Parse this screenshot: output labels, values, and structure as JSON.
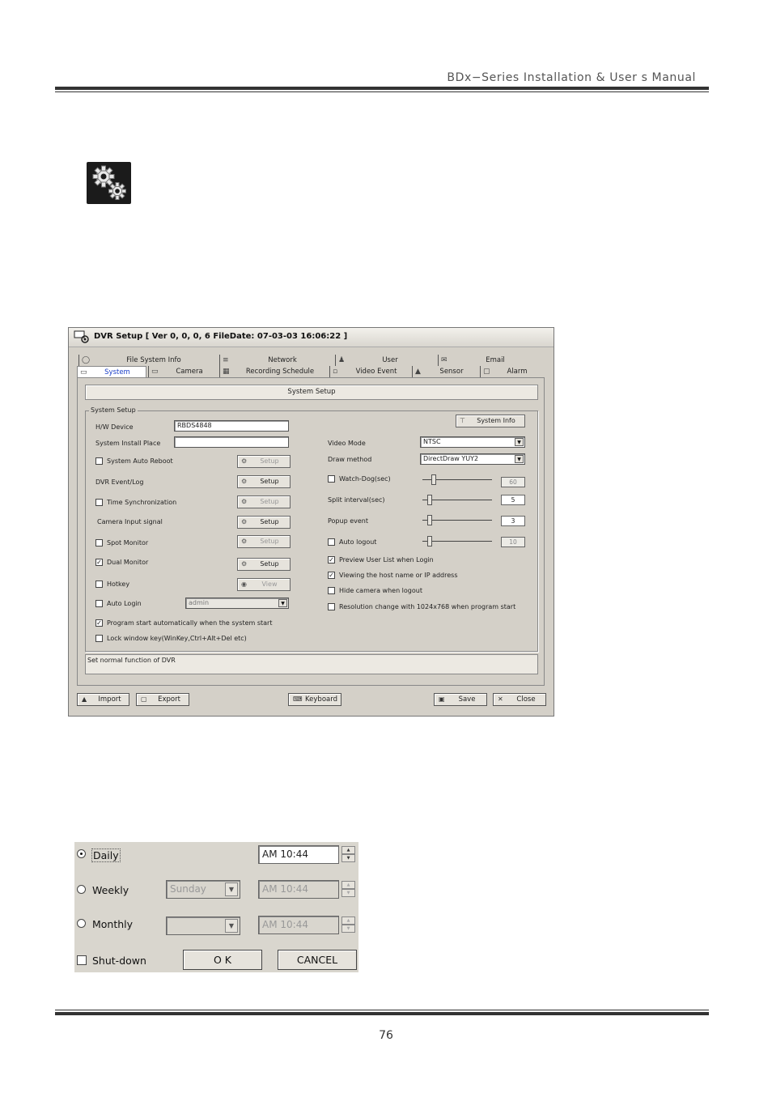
{
  "header": {
    "title": "BDx−Series Installation & User s Manual"
  },
  "window": {
    "title": "DVR Setup [ Ver 0, 0, 0, 6   FileDate: 07-03-03 16:06:22 ]",
    "tabs_top": [
      "File System Info",
      "Network",
      "User",
      "Email"
    ],
    "tabs_bottom": [
      "System",
      "Camera",
      "Recording Schedule",
      "Video Event",
      "Sensor",
      "Alarm"
    ],
    "section_title": "System Setup",
    "group_title": "System Setup",
    "left": {
      "hw_device_label": "H/W Device",
      "hw_device_value": "RBDS4848",
      "install_place_label": "System Install Place",
      "install_place_value": "",
      "auto_reboot": "System Auto Reboot",
      "event_log": "DVR Event/Log",
      "time_sync": "Time Synchronization",
      "camera_input": "Camera Input signal",
      "spot_monitor": "Spot Monitor",
      "dual_monitor": "Dual Monitor",
      "hotkey": "Hotkey",
      "auto_login": "Auto Login",
      "auto_login_user": "admin",
      "program_start": "Program start automatically when the system start",
      "lock_window": "Lock window key(WinKey,Ctrl+Alt+Del etc)",
      "setup_label": "Setup",
      "view_label": "View"
    },
    "right": {
      "system_info_btn": "System Info",
      "video_mode_label": "Video Mode",
      "video_mode_value": "NTSC",
      "draw_method_label": "Draw method",
      "draw_method_value": "DirectDraw YUY2",
      "watchdog_label": "Watch-Dog(sec)",
      "watchdog_value": "60",
      "split_label": "Split interval(sec)",
      "split_value": "5",
      "popup_label": "Popup event",
      "popup_value": "3",
      "auto_logout_label": "Auto logout",
      "auto_logout_value": "10",
      "preview_user": "Preview User List when Login",
      "viewing_host": "Viewing the host name or IP address",
      "hide_camera": "Hide camera when logout",
      "resolution_change": "Resolution change with 1024x768 when program start"
    },
    "status": "Set normal function of DVR",
    "footer": {
      "import": "Import",
      "export": "Export",
      "keyboard": "Keyboard",
      "save": "Save",
      "close": "Close"
    }
  },
  "schedule": {
    "daily": "Daily",
    "weekly": "Weekly",
    "monthly": "Monthly",
    "shutdown": "Shut-down",
    "daily_time": "AM 10:44",
    "weekly_day": "Sunday",
    "weekly_time": "AM 10:44",
    "monthly_day": "",
    "monthly_time": "AM 10:44",
    "ok": "O   K",
    "cancel": "CANCEL"
  },
  "page_number": "76"
}
